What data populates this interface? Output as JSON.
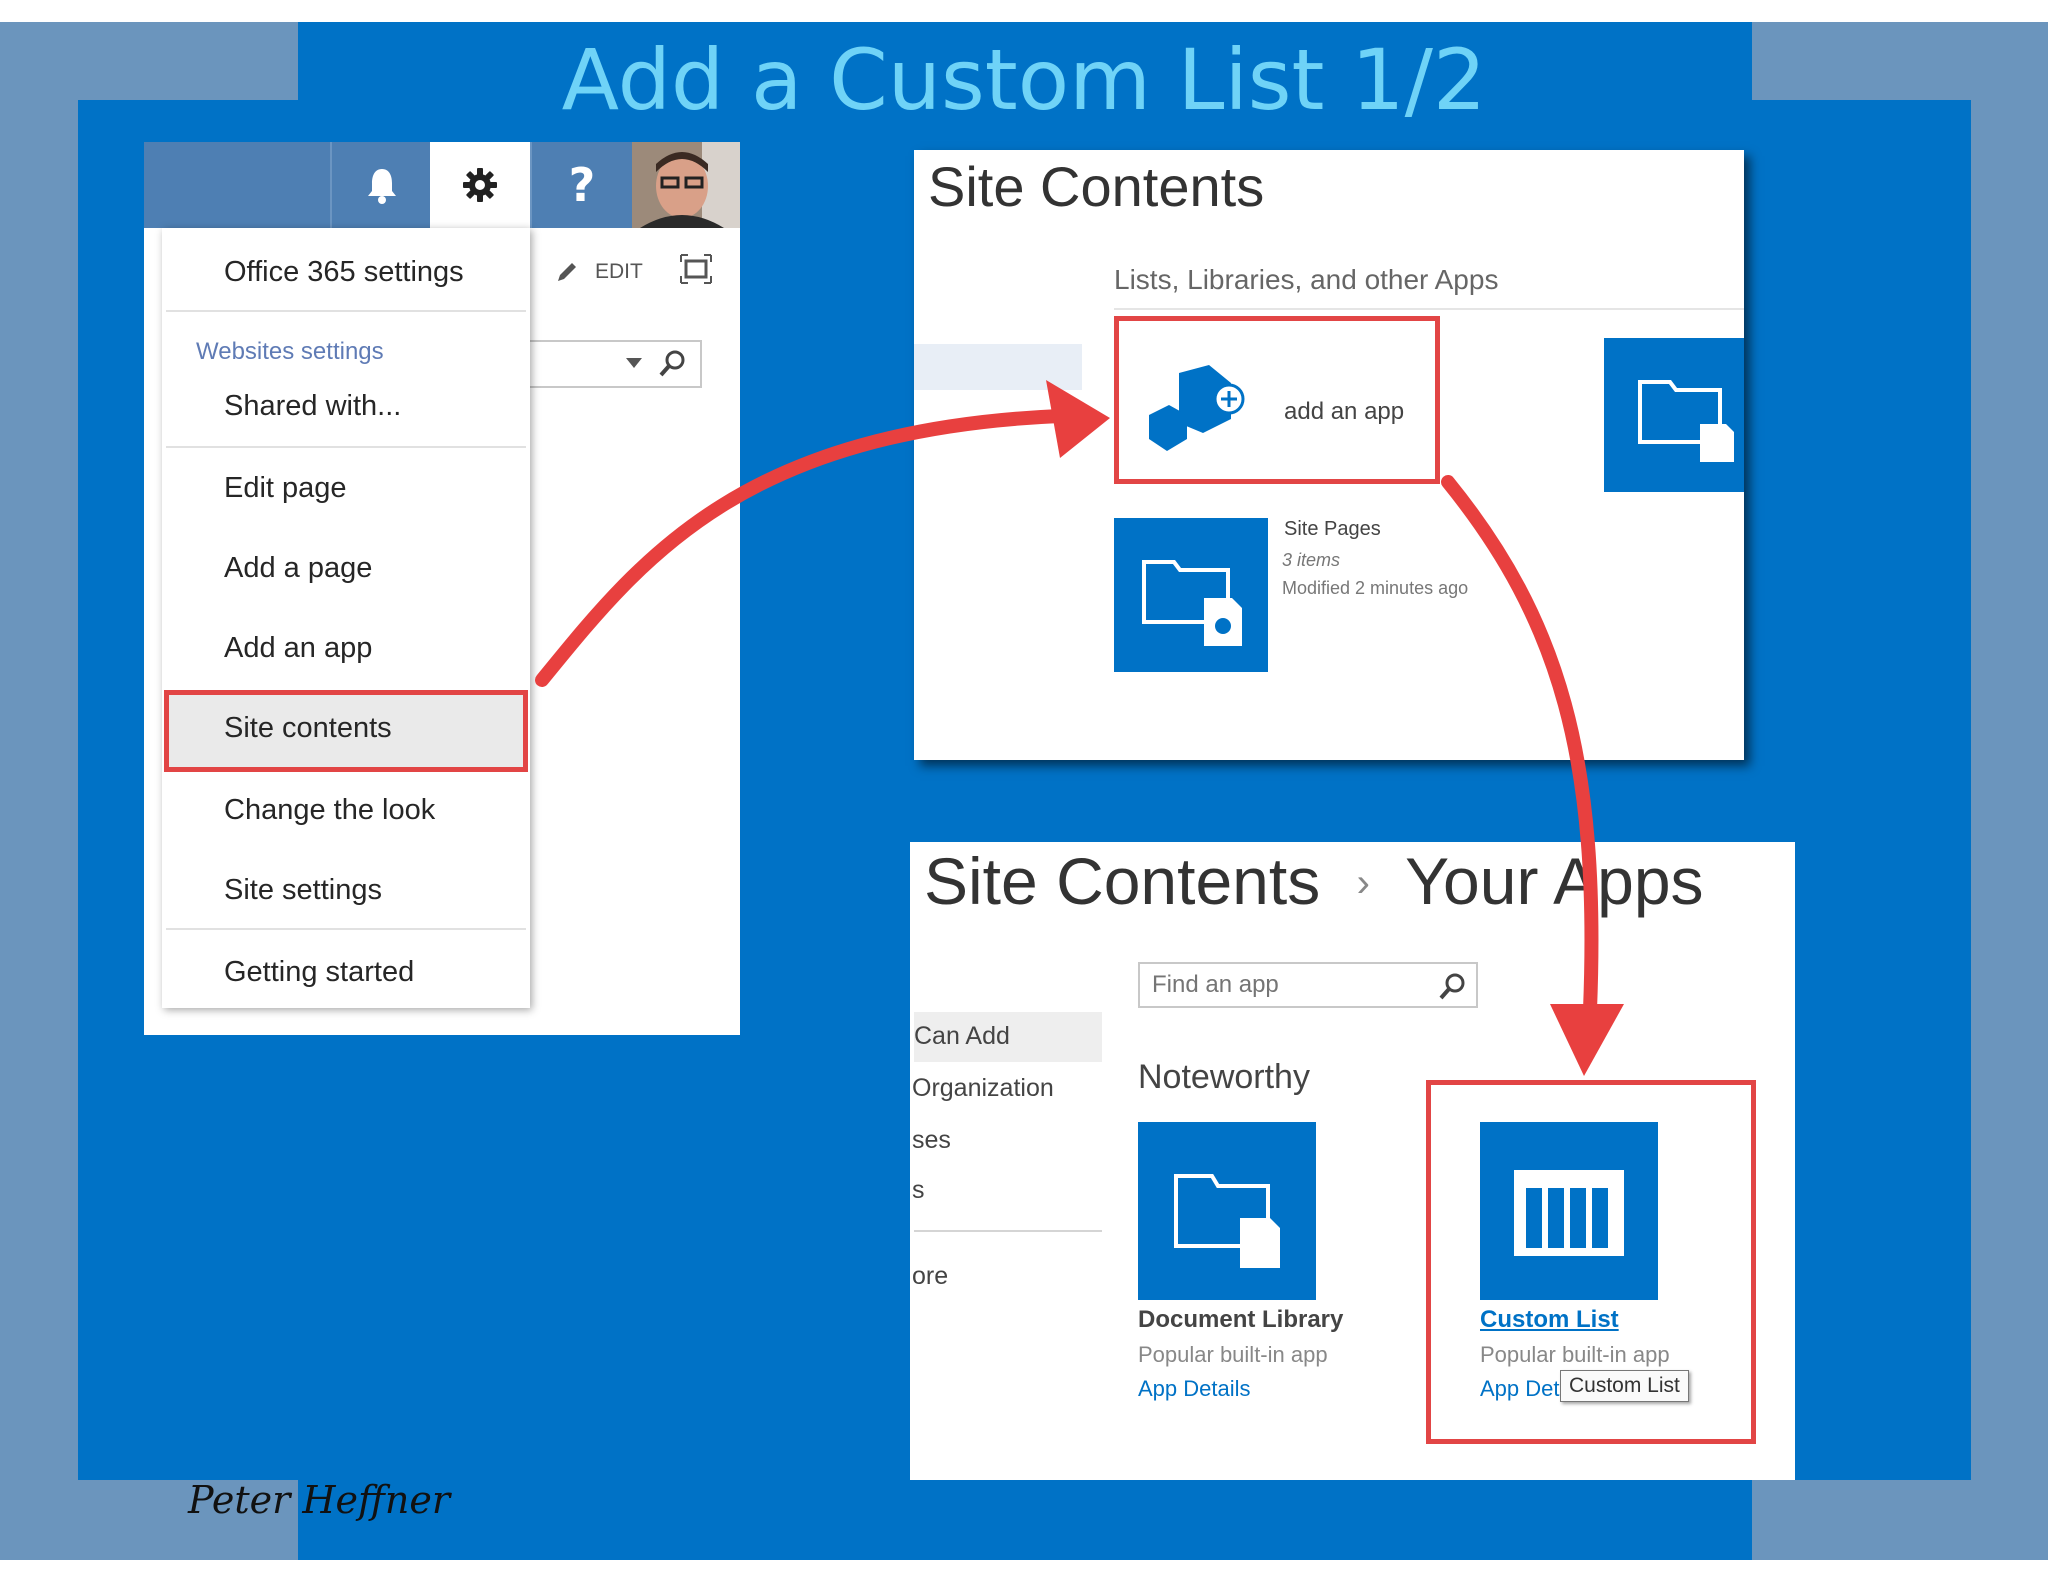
{
  "slide": {
    "title": "Add a Custom List 1/2",
    "signature": "Peter Heffner"
  },
  "settings_panel": {
    "toolbar": {
      "edit_label": "EDIT"
    },
    "menu": {
      "office365_settings": "Office 365 settings",
      "group_label": "Websites settings",
      "shared_with": "Shared with...",
      "edit_page": "Edit page",
      "add_page": "Add a page",
      "add_app": "Add an app",
      "site_contents": "Site contents",
      "change_look": "Change the look",
      "site_settings": "Site settings",
      "getting_started": "Getting started"
    },
    "highlighted_item": "Site contents"
  },
  "site_contents_panel": {
    "title": "Site Contents",
    "subtitle": "Lists, Libraries, and other Apps",
    "add_app_label": "add an app",
    "site_pages": {
      "name": "Site Pages",
      "items": "3 items",
      "modified": "Modified 2 minutes ago"
    }
  },
  "your_apps_panel": {
    "breadcrumb_root": "Site Contents",
    "breadcrumb_sep": "›",
    "breadcrumb_current": "Your Apps",
    "search_placeholder": "Find an app",
    "nav": {
      "can_add": "Can Add",
      "organization": "Organization",
      "ses": "ses",
      "s": "s",
      "ore": "ore"
    },
    "section_title": "Noteworthy",
    "apps": [
      {
        "name": "Document Library",
        "subtitle": "Popular built-in app",
        "link": "App Details"
      },
      {
        "name": "Custom List",
        "subtitle": "Popular built-in app",
        "link": "App Det"
      }
    ],
    "tooltip": "Custom List"
  },
  "colors": {
    "slide_blue": "#0072c6",
    "title_cyan": "#6fd3f7",
    "frame_gray_blue": "#6b95bd",
    "highlight_red": "#e24545",
    "suitebar": "#4e7fb3"
  }
}
